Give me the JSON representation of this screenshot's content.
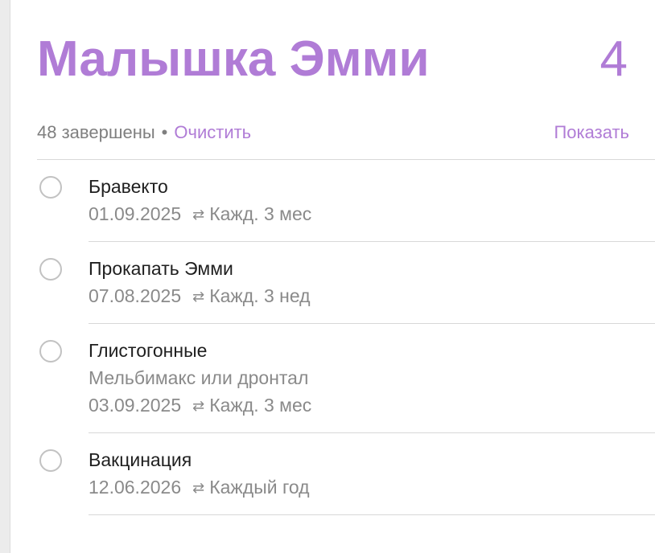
{
  "colors": {
    "accent": "#b07cd6",
    "text_primary": "#1f1f1f",
    "text_secondary": "#8a8a8a",
    "divider": "#d8d8d8",
    "checkbox_border": "#c2c2c2"
  },
  "header": {
    "title": "Малышка Эмми",
    "count": "4"
  },
  "summary": {
    "completed_text": "48 завершены",
    "separator": "•",
    "clear_label": "Очистить",
    "show_label": "Показать"
  },
  "reminders": [
    {
      "title": "Бравекто",
      "note": "",
      "date": "01.09.2025",
      "repeat_icon": "repeat-icon",
      "repeat": "Кажд. 3 мес"
    },
    {
      "title": "Прокапать Эмми",
      "note": "",
      "date": "07.08.2025",
      "repeat_icon": "repeat-icon",
      "repeat": "Кажд. 3 нед"
    },
    {
      "title": "Глистогонные",
      "note": "Мельбимакс или дронтал",
      "date": "03.09.2025",
      "repeat_icon": "repeat-icon",
      "repeat": "Кажд. 3 мес"
    },
    {
      "title": "Вакцинация",
      "note": "",
      "date": "12.06.2026",
      "repeat_icon": "repeat-icon",
      "repeat": "Каждый год"
    }
  ]
}
